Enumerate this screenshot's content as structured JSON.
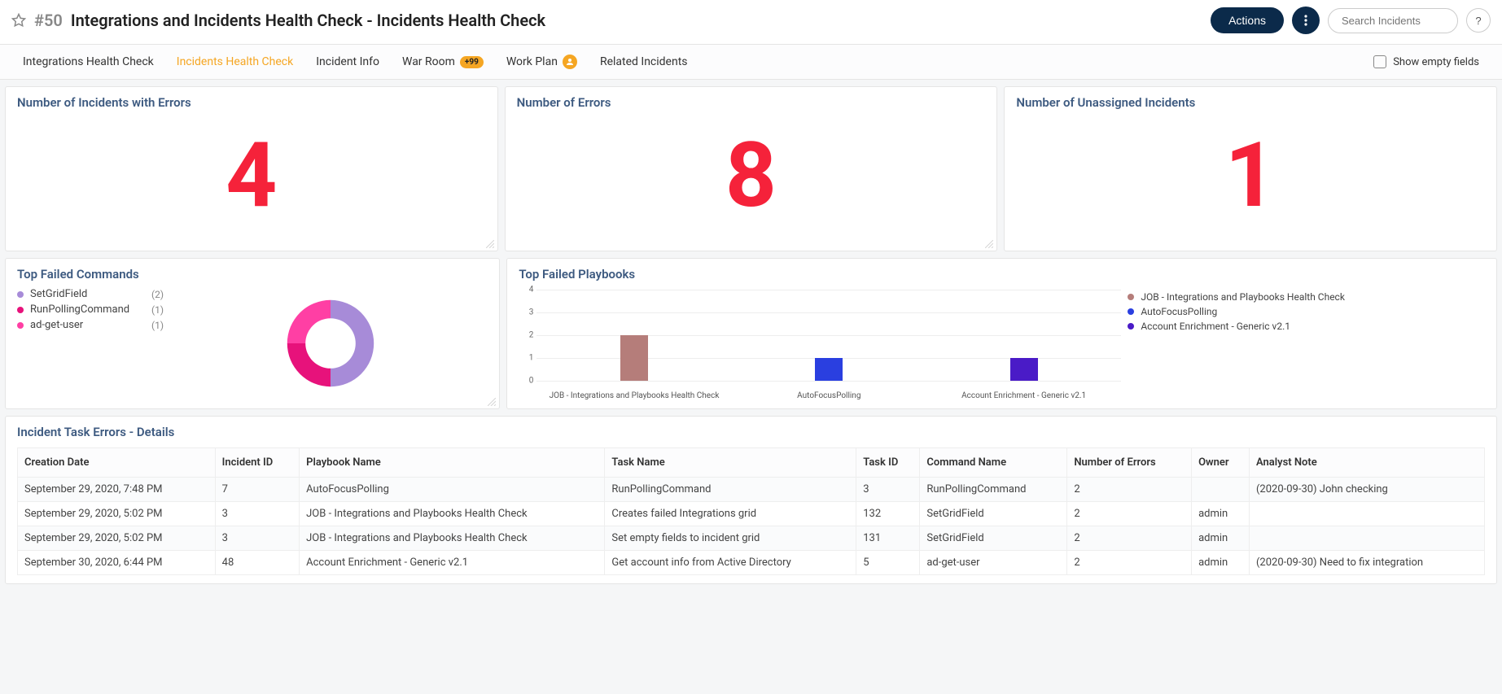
{
  "header": {
    "id": "#50",
    "title": "Integrations and Incidents Health Check - Incidents Health Check",
    "actions_label": "Actions",
    "search_placeholder": "Search Incidents",
    "help_label": "?"
  },
  "tabs": {
    "items": [
      {
        "label": "Integrations Health Check",
        "active": false
      },
      {
        "label": "Incidents Health Check",
        "active": true
      },
      {
        "label": "Incident Info",
        "active": false
      },
      {
        "label": "War Room",
        "badge": "+99",
        "active": false
      },
      {
        "label": "Work Plan",
        "avatar": true,
        "active": false
      },
      {
        "label": "Related Incidents",
        "active": false
      }
    ],
    "show_empty_label": "Show empty fields"
  },
  "cards": {
    "incidents_errors": {
      "title": "Number of Incidents with Errors",
      "value": "4"
    },
    "num_errors": {
      "title": "Number of Errors",
      "value": "8"
    },
    "unassigned": {
      "title": "Number of Unassigned Incidents",
      "value": "1"
    }
  },
  "failed_commands": {
    "title": "Top Failed Commands",
    "items": [
      {
        "label": "SetGridField",
        "count": "(2)",
        "color": "#a78bd8"
      },
      {
        "label": "RunPollingCommand",
        "count": "(1)",
        "color": "#e7127b"
      },
      {
        "label": "ad-get-user",
        "count": "(1)",
        "color": "#ff3fa4"
      }
    ]
  },
  "failed_playbooks": {
    "title": "Top Failed Playbooks",
    "series": [
      {
        "label": "JOB - Integrations and Playbooks Health Check",
        "value": 2,
        "color": "#b57d7a"
      },
      {
        "label": "AutoFocusPolling",
        "value": 1,
        "color": "#2a3fe0"
      },
      {
        "label": "Account Enrichment - Generic v2.1",
        "value": 1,
        "color": "#4a1bc7"
      }
    ],
    "ymax": 4
  },
  "chart_data": [
    {
      "type": "pie",
      "title": "Top Failed Commands",
      "categories": [
        "SetGridField",
        "RunPollingCommand",
        "ad-get-user"
      ],
      "values": [
        2,
        1,
        1
      ]
    },
    {
      "type": "bar",
      "title": "Top Failed Playbooks",
      "categories": [
        "JOB - Integrations and Playbooks Health Check",
        "AutoFocusPolling",
        "Account Enrichment - Generic v2.1"
      ],
      "values": [
        2,
        1,
        1
      ],
      "ylim": [
        0,
        4
      ],
      "xlabel": "",
      "ylabel": ""
    }
  ],
  "task_errors": {
    "title": "Incident Task Errors - Details",
    "columns": [
      "Creation Date",
      "Incident ID",
      "Playbook Name",
      "Task Name",
      "Task ID",
      "Command Name",
      "Number of Errors",
      "Owner",
      "Analyst Note"
    ],
    "rows": [
      {
        "date": "September 29, 2020, 7:48 PM",
        "iid": "7",
        "playbook": "AutoFocusPolling",
        "task": "RunPollingCommand",
        "tid": "3",
        "cmd": "RunPollingCommand",
        "nerr": "2",
        "owner": "",
        "note": "(2020-09-30) John checking"
      },
      {
        "date": "September 29, 2020, 5:02 PM",
        "iid": "3",
        "playbook": "JOB - Integrations and Playbooks Health Check",
        "task": "Creates failed Integrations grid",
        "tid": "132",
        "cmd": "SetGridField",
        "nerr": "2",
        "owner": "admin",
        "note": ""
      },
      {
        "date": "September 29, 2020, 5:02 PM",
        "iid": "3",
        "playbook": "JOB - Integrations and Playbooks Health Check",
        "task": "Set empty fields to incident grid",
        "tid": "131",
        "cmd": "SetGridField",
        "nerr": "2",
        "owner": "admin",
        "note": ""
      },
      {
        "date": "September 30, 2020, 6:44 PM",
        "iid": "48",
        "playbook": "Account Enrichment - Generic v2.1",
        "task": "Get account info from Active Directory",
        "tid": "5",
        "cmd": "ad-get-user",
        "nerr": "2",
        "owner": "admin",
        "note": "(2020-09-30) Need to fix integration"
      }
    ]
  }
}
